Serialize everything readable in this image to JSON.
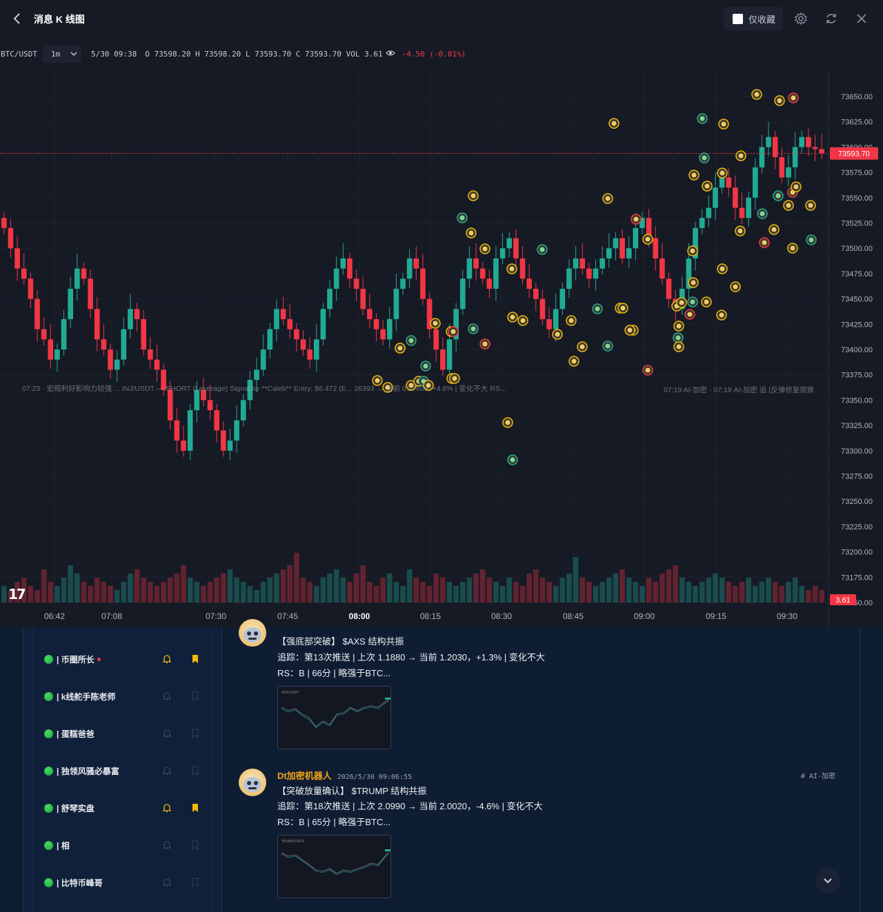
{
  "header": {
    "title": "消息 K 线图",
    "fav_only_label": "仅收藏"
  },
  "legend": {
    "symbol": "BTC/USDT",
    "timeframe": "1m",
    "date": "5/30 09:38",
    "ohlc": "O 73598.20  H 73598.20  L 73593.70  C 73593.70  VOL 3.61",
    "change": "-4.50 (-0.01%)"
  },
  "chart_data": {
    "type": "candlestick",
    "symbol": "BTC/USDT",
    "last_price": 73593.7,
    "last_volume_label": "3.61",
    "price_label": "73593.70",
    "y_ticks": [
      "73650.00",
      "73625.00",
      "73600.00",
      "73575.00",
      "73550.00",
      "73525.00",
      "73500.00",
      "73475.00",
      "73450.00",
      "73425.00",
      "73400.00",
      "73375.00",
      "73350.00",
      "73325.00",
      "73300.00",
      "73275.00",
      "73250.00",
      "73225.00",
      "73200.00",
      "73175.00",
      "73150.00"
    ],
    "x_ticks": [
      {
        "label": "06:42",
        "bold": false
      },
      {
        "label": "07:08",
        "bold": false
      },
      {
        "label": "07:30",
        "bold": false
      },
      {
        "label": "07:45",
        "bold": false
      },
      {
        "label": "08:00",
        "bold": true
      },
      {
        "label": "08:15",
        "bold": false
      },
      {
        "label": "08:30",
        "bold": false
      },
      {
        "label": "08:45",
        "bold": false
      },
      {
        "label": "09:00",
        "bold": false
      },
      {
        "label": "09:15",
        "bold": false
      },
      {
        "label": "09:30",
        "bold": false
      }
    ],
    "ylim": [
      73150,
      73670
    ],
    "close_path": [
      73520,
      73500,
      73480,
      73470,
      73450,
      73420,
      73410,
      73390,
      73400,
      73430,
      73460,
      73480,
      73470,
      73440,
      73410,
      73400,
      73380,
      73390,
      73420,
      73440,
      73430,
      73400,
      73390,
      73380,
      73360,
      73330,
      73310,
      73300,
      73340,
      73360,
      73350,
      73340,
      73320,
      73300,
      73310,
      73330,
      73350,
      73370,
      73380,
      73400,
      73420,
      73440,
      73430,
      73420,
      73410,
      73400,
      73390,
      73410,
      73440,
      73460,
      73480,
      73490,
      73470,
      73460,
      73440,
      73430,
      73420,
      73410,
      73430,
      73460,
      73470,
      73490,
      73480,
      73450,
      73420,
      73400,
      73380,
      73410,
      73440,
      73470,
      73490,
      73480,
      73470,
      73460,
      73490,
      73500,
      73510,
      73490,
      73470,
      73460,
      73450,
      73430,
      73420,
      73440,
      73460,
      73480,
      73490,
      73480,
      73470,
      73480,
      73490,
      73500,
      73510,
      73490,
      73500,
      73520,
      73530,
      73510,
      73490,
      73470,
      73450,
      73440,
      73460,
      73490,
      73520,
      73530,
      73540,
      73560,
      73570,
      73560,
      73540,
      73530,
      73550,
      73580,
      73600,
      73610,
      73590,
      73570,
      73580,
      73600,
      73610,
      73600,
      73598,
      73594
    ],
    "volumes": [
      4,
      3,
      5,
      6,
      4,
      3,
      8,
      5,
      4,
      6,
      9,
      7,
      5,
      4,
      6,
      5,
      4,
      3,
      5,
      7,
      8,
      6,
      5,
      4,
      5,
      6,
      7,
      9,
      6,
      5,
      4,
      5,
      6,
      7,
      8,
      6,
      5,
      4,
      3,
      5,
      6,
      7,
      8,
      9,
      12,
      6,
      5,
      4,
      6,
      7,
      8,
      6,
      5,
      7,
      9,
      5,
      4,
      6,
      7,
      5,
      4,
      8,
      6,
      5,
      4,
      7,
      6,
      5,
      4,
      5,
      6,
      7,
      8,
      6,
      5,
      4,
      6,
      5,
      4,
      7,
      8,
      6,
      5,
      4,
      6,
      7,
      11,
      6,
      5,
      4,
      5,
      6,
      7,
      8,
      6,
      5,
      4,
      6,
      5,
      7,
      8,
      9,
      6,
      5,
      4,
      5,
      6,
      7,
      6,
      5,
      4,
      5,
      6,
      4,
      5,
      6,
      5,
      4,
      5,
      6,
      4,
      3,
      4,
      3
    ]
  },
  "chart_overlay": {
    "ticker_row": "07:23 · 宏观利好影响力较强 ... INJ/USDT — SHORT (Leverage) Signal by **Caleb** Entry: $6.472 (E... 26393 → 当前 0.27606, +4.6% | 变化不大 RS...",
    "ticker_right": "07:19 AI-加密 · 07:19 AI-加密 追 [反弹修复观察"
  },
  "channels": [
    {
      "name": "| 币圈所长",
      "unread": true,
      "bell_on": true,
      "bookmarked": true
    },
    {
      "name": "| k线舵手陈老师",
      "unread": false,
      "bell_on": false,
      "bookmarked": false
    },
    {
      "name": "| 蛋糕爸爸",
      "unread": false,
      "bell_on": false,
      "bookmarked": false
    },
    {
      "name": "| 独领风骚必暴富",
      "unread": false,
      "bell_on": false,
      "bookmarked": false
    },
    {
      "name": "| 舒琴实盘",
      "unread": false,
      "bell_on": true,
      "bookmarked": true
    },
    {
      "name": "| 相",
      "unread": false,
      "bell_on": false,
      "bookmarked": false
    },
    {
      "name": "| 比特币峰哥",
      "unread": false,
      "bell_on": false,
      "bookmarked": false
    }
  ],
  "messages": [
    {
      "author": "",
      "time": "",
      "tag": "",
      "title": "【强底部突破】 $AXS 结构共振",
      "track": "追踪：第13次推送 | 上次 1.1880 → 当前 1.2030，+1.3% | 变化不大",
      "rs": "RS：B | 66分 | 略强于BTC..."
    },
    {
      "author": "Dt加密机器人",
      "time": "2026/5/30 09:06:55",
      "tag": "# AI-加密",
      "title": "【突破放量确认】 $TRUMP 结构共振",
      "track": "追踪：第18次推送 | 上次 2.0990 → 当前 2.0020，-4.6% | 变化不大",
      "rs": "RS：B | 65分 | 略强于BTC..."
    }
  ],
  "colors": {
    "up": "#22ab94",
    "down": "#f23645",
    "accent": "#f0a31a",
    "background": "#161a25"
  }
}
